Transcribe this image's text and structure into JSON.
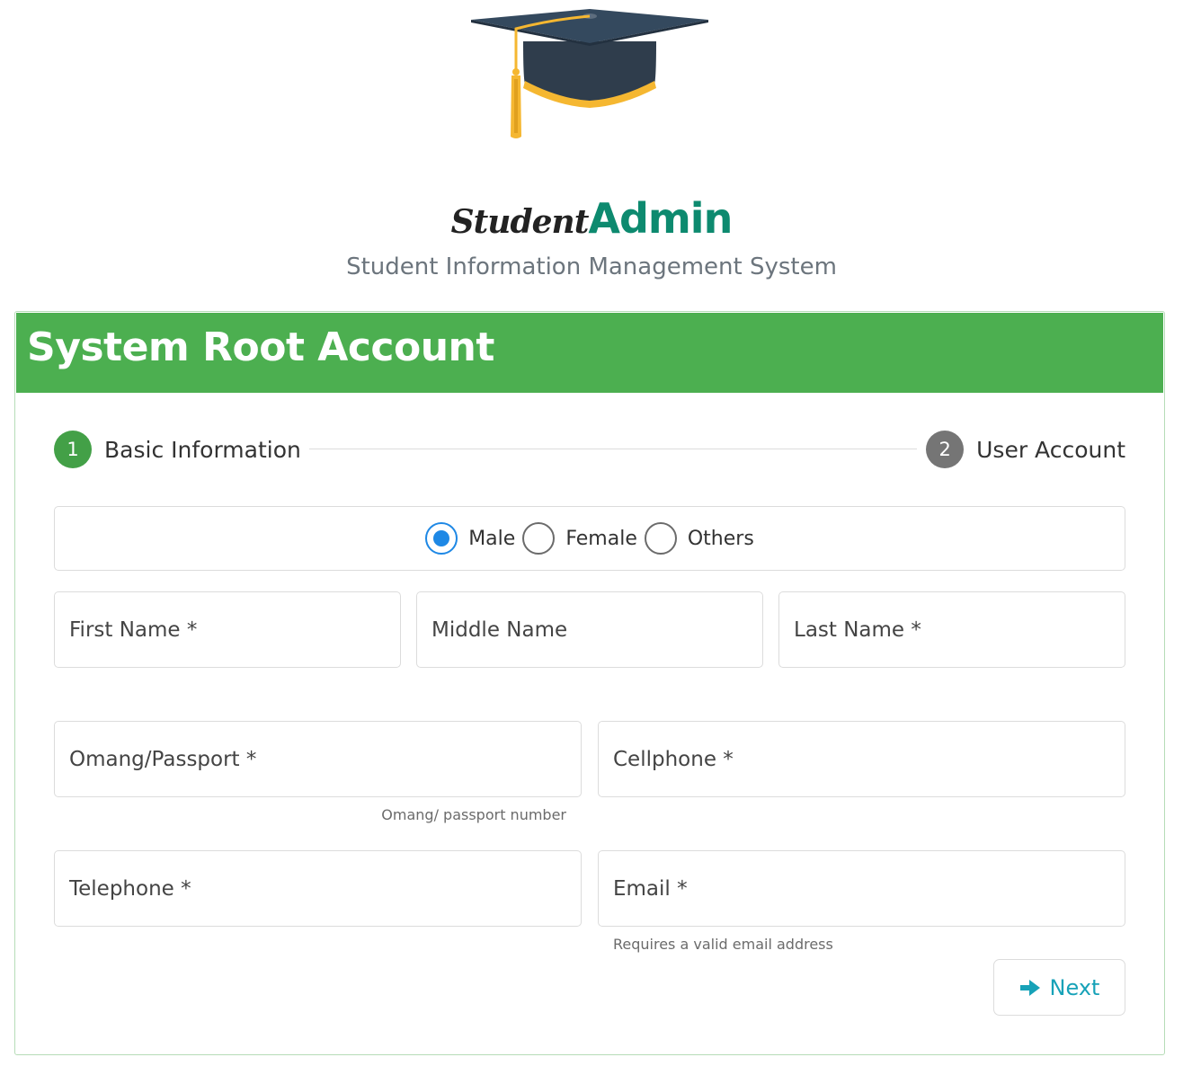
{
  "brand": {
    "part1": "Student",
    "part2": "Admin",
    "tagline": "Student Information Management System"
  },
  "card": {
    "title": "System Root Account"
  },
  "stepper": {
    "steps": [
      {
        "number": "1",
        "label": "Basic Information",
        "status": "active"
      },
      {
        "number": "2",
        "label": "User Account",
        "status": "pending"
      }
    ]
  },
  "gender": {
    "selected": "Male",
    "options": [
      "Male",
      "Female",
      "Others"
    ]
  },
  "fields": {
    "first_name": {
      "placeholder": "First Name *",
      "value": ""
    },
    "middle_name": {
      "placeholder": "Middle Name",
      "value": ""
    },
    "last_name": {
      "placeholder": "Last Name *",
      "value": ""
    },
    "passport": {
      "placeholder": "Omang/Passport *",
      "value": "",
      "hint": "Omang/ passport number"
    },
    "cellphone": {
      "placeholder": "Cellphone *",
      "value": ""
    },
    "telephone": {
      "placeholder": "Telephone *",
      "value": ""
    },
    "email": {
      "placeholder": "Email *",
      "value": "",
      "hint": "Requires a valid email address"
    }
  },
  "actions": {
    "next_label": "Next",
    "next_icon": "arrow-right-icon"
  },
  "colors": {
    "header_green": "#4caf50",
    "brand_teal": "#0d8a6f",
    "step_active": "#43a047",
    "step_inactive": "#757575",
    "radio_blue": "#1e88e5",
    "button_text": "#17a2b8"
  }
}
